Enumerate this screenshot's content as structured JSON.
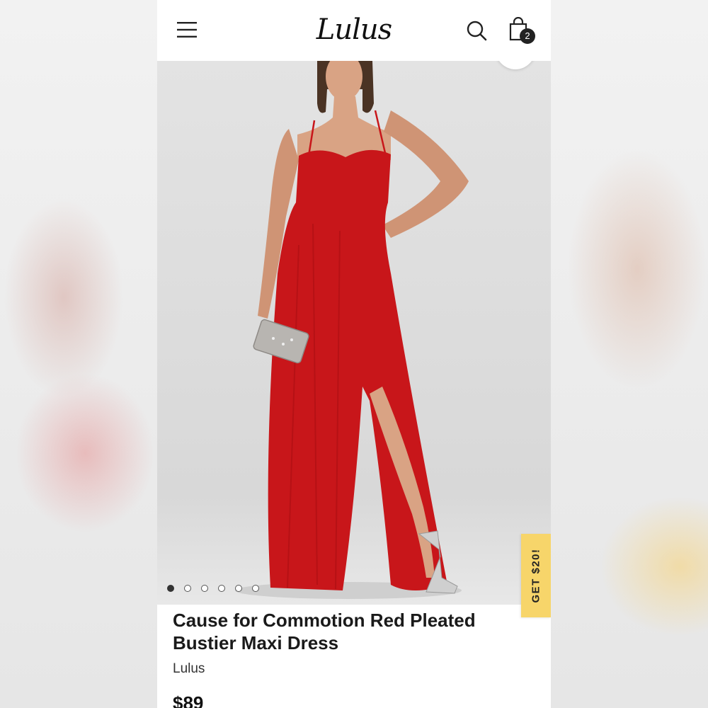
{
  "header": {
    "logo_text": "Lulus",
    "cart_count": "2"
  },
  "gallery": {
    "image_count": 6,
    "active_index": 0
  },
  "promo_tab": {
    "label": "GET $20!"
  },
  "product": {
    "title": "Cause for Commotion Red Pleated Bustier Maxi Dress",
    "brand": "Lulus",
    "price": "$89"
  },
  "icons": {
    "menu": "menu-icon",
    "search": "search-icon",
    "cart": "shopping-bag-icon"
  },
  "colors": {
    "dress": "#c8161a",
    "promo": "#f7d56a",
    "badge": "#222222"
  }
}
